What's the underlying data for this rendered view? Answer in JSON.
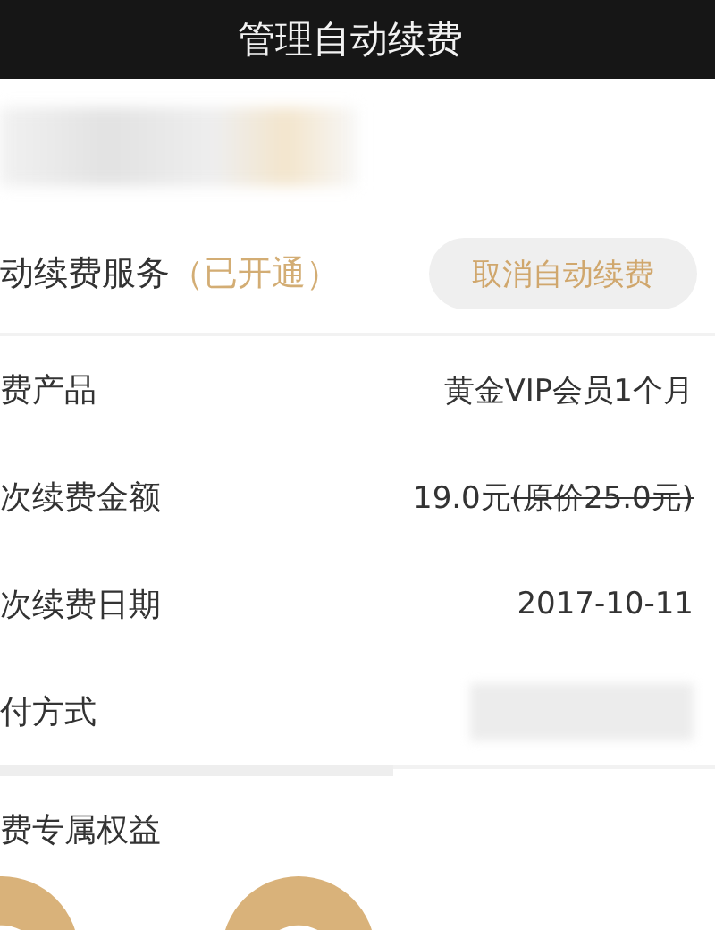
{
  "header": {
    "title": "管理自动续费"
  },
  "service": {
    "label": "动续费服务",
    "status": "（已开通）",
    "button": "取消自动续费"
  },
  "rows": [
    {
      "label": "费产品",
      "value": "黄金VIP会员1个月"
    },
    {
      "label": "次续费金额",
      "value": "19.0元",
      "original_price": "(原价25.0元)"
    },
    {
      "label": "次续费日期",
      "value": "2017-10-11"
    },
    {
      "label": "付方式",
      "redacted": true
    }
  ],
  "benefits": {
    "title": "费专属权益"
  }
}
